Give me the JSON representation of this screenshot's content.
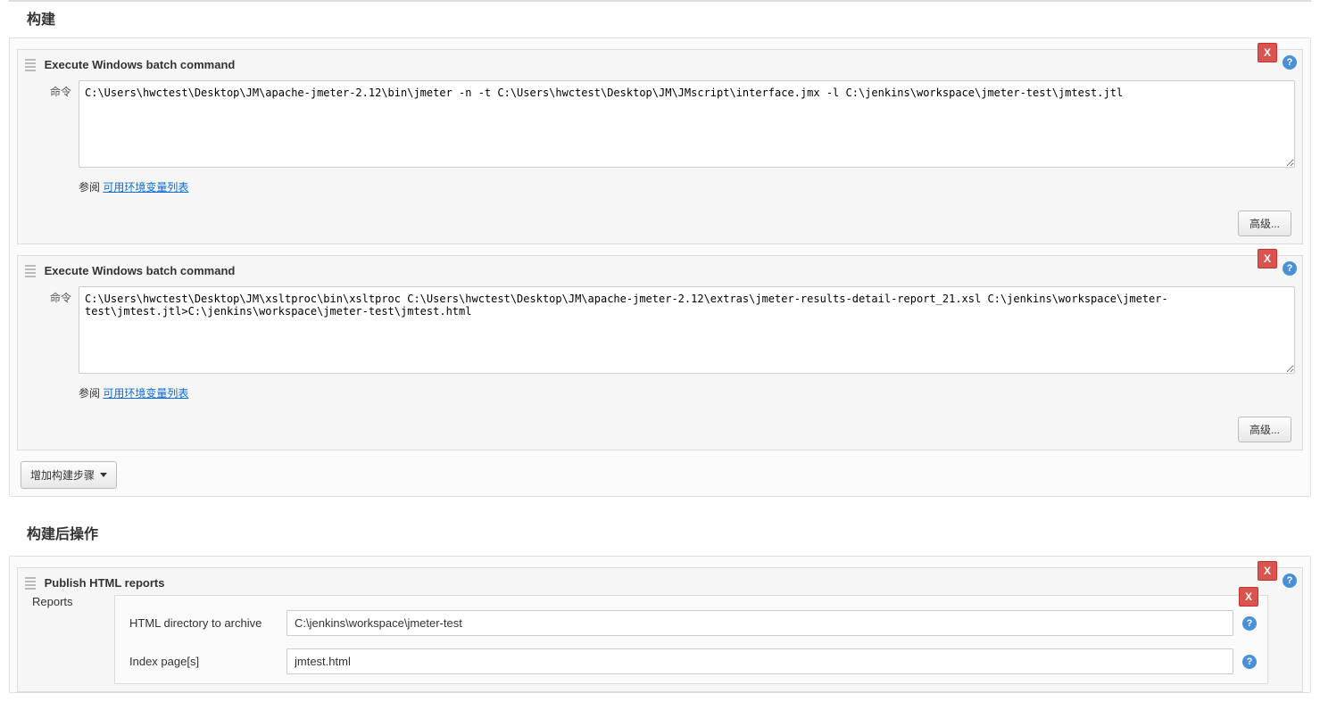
{
  "build": {
    "title": "构建",
    "steps": [
      {
        "header": "Execute Windows batch command",
        "cmd_label": "命令",
        "cmd_value": "C:\\Users\\hwctest\\Desktop\\JM\\apache-jmeter-2.12\\bin\\jmeter -n -t C:\\Users\\hwctest\\Desktop\\JM\\JMscript\\interface.jmx -l C:\\jenkins\\workspace\\jmeter-test\\jmtest.jtl",
        "helper_prefix": "参阅 ",
        "helper_link": "可用环境变量列表",
        "advanced": "高级..."
      },
      {
        "header": "Execute Windows batch command",
        "cmd_label": "命令",
        "cmd_value": "C:\\Users\\hwctest\\Desktop\\JM\\xsltproc\\bin\\xsltproc C:\\Users\\hwctest\\Desktop\\JM\\apache-jmeter-2.12\\extras\\jmeter-results-detail-report_21.xsl C:\\jenkins\\workspace\\jmeter-test\\jmtest.jtl>C:\\jenkins\\workspace\\jmeter-test\\jmtest.html",
        "helper_prefix": "参阅 ",
        "helper_link": "可用环境变量列表",
        "advanced": "高级..."
      }
    ],
    "add_step": "增加构建步骤"
  },
  "post_build": {
    "title": "构建后操作",
    "publish_header": "Publish HTML reports",
    "reports_label": "Reports",
    "html_dir_label": "HTML directory to archive",
    "html_dir_value": "C:\\jenkins\\workspace\\jmeter-test",
    "index_label": "Index page[s]",
    "index_value": "jmtest.html"
  },
  "icons": {
    "help": "?",
    "delete": "X"
  }
}
